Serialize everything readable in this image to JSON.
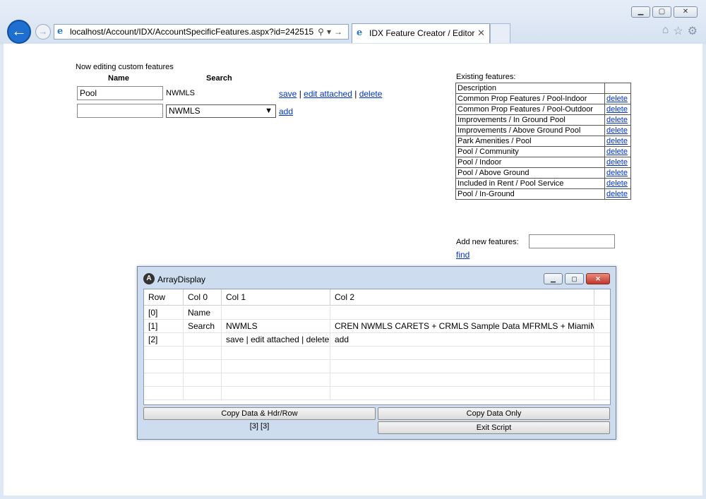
{
  "browser": {
    "address": "localhost/Account/IDX/AccountSpecificFeatures.aspx?id=242515",
    "tab_title": "IDX Feature Creator / Editor",
    "tab_close": "✕"
  },
  "editor": {
    "title": "Now editing custom features",
    "col_name": "Name",
    "col_search": "Search",
    "row1": {
      "name_value": "Pool",
      "search_value": "NWMLS",
      "save": "save",
      "sep": "|",
      "edit_attached": "edit attached",
      "delete": "delete"
    },
    "row2": {
      "name_value": "",
      "select_value": "NWMLS",
      "add": "add"
    }
  },
  "existing": {
    "title": "Existing features:",
    "header": "Description",
    "delete_label": "delete",
    "items": [
      "Common Prop Features / Pool-Indoor",
      "Common Prop Features / Pool-Outdoor",
      "Improvements / In Ground Pool",
      "Improvements / Above Ground Pool",
      "Park Amenities / Pool",
      "Pool / Community",
      "Pool / Indoor",
      "Pool / Above Ground",
      "Included in Rent / Pool Service",
      "Pool / In-Ground"
    ],
    "add_new_label": "Add new features:",
    "add_new_value": "",
    "find_label": "find"
  },
  "array_display": {
    "title": "ArrayDisplay",
    "headers": [
      "Row",
      "Col 0",
      "Col 1",
      "Col 2"
    ],
    "rows": [
      [
        "[0]",
        "Name",
        "",
        ""
      ],
      [
        "[1]",
        "Search",
        "NWMLS",
        "CREN NWMLS CARETS + CRMLS Sample Data MFRMLS + MiamiMLS"
      ],
      [
        "[2]",
        "",
        "save | edit attached | delete",
        "add"
      ]
    ],
    "buttons": {
      "copy_hdr": "Copy Data & Hdr/Row",
      "copy_only": "Copy Data Only",
      "exit": "Exit Script"
    },
    "status": "[3] [3]"
  }
}
